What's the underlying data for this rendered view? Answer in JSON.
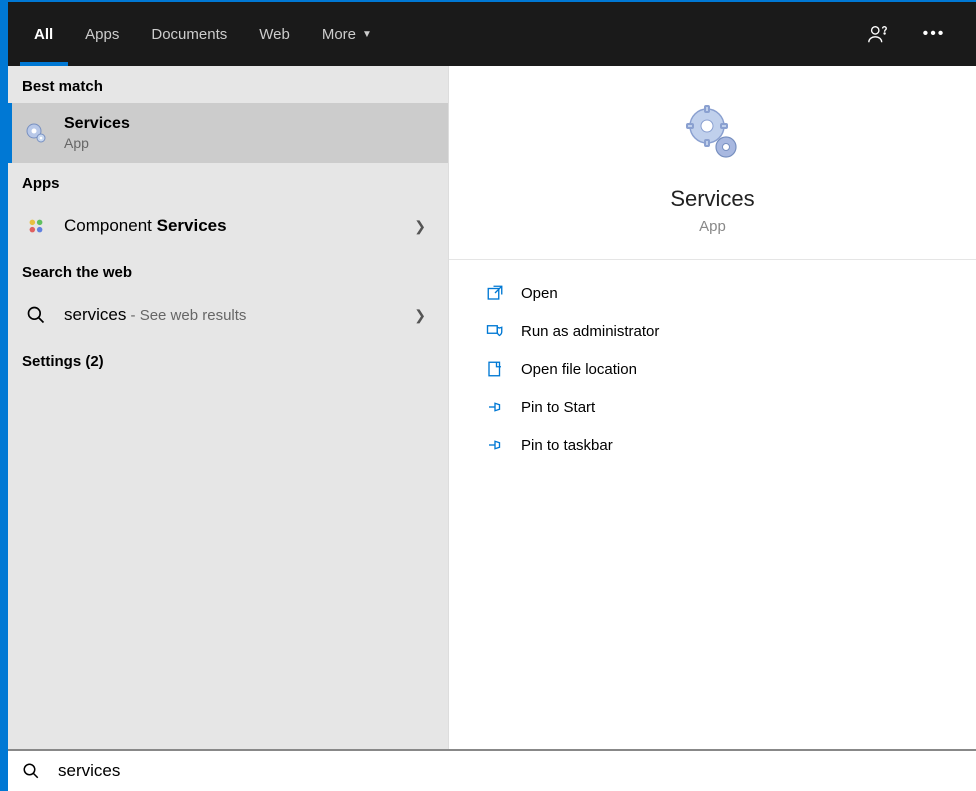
{
  "header": {
    "tabs": [
      "All",
      "Apps",
      "Documents",
      "Web",
      "More"
    ]
  },
  "left": {
    "best_match_header": "Best match",
    "best_match": {
      "title": "Services",
      "sub": "App"
    },
    "apps_header": "Apps",
    "apps_item_prefix": "Component ",
    "apps_item_bold": "Services",
    "web_header": "Search the web",
    "web_query": "services",
    "web_suffix": " - See web results",
    "settings_header": "Settings (2)"
  },
  "preview": {
    "title": "Services",
    "sub": "App",
    "actions": [
      "Open",
      "Run as administrator",
      "Open file location",
      "Pin to Start",
      "Pin to taskbar"
    ]
  },
  "search": {
    "value": "services"
  }
}
